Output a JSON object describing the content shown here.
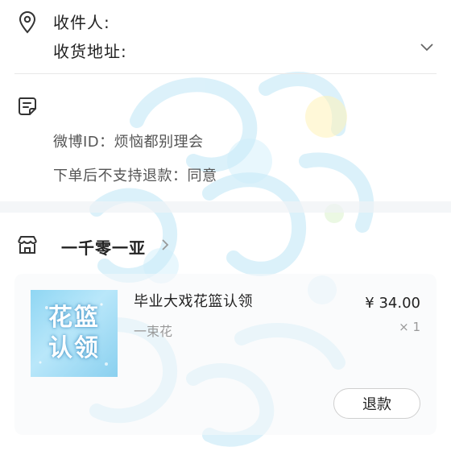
{
  "address": {
    "recipient_label": "收件人:",
    "address_label": "收货地址:"
  },
  "note": {
    "weibo_line": "微博ID：烦恼都别理会",
    "refund_policy_line": "下单后不支持退款：同意"
  },
  "shop": {
    "name": "一千零一亚"
  },
  "product": {
    "title": "毕业大戏花篮认领",
    "variant": "一束花",
    "price": "¥ 34.00",
    "quantity": "× 1",
    "thumbnail_text_line1": "花篮",
    "thumbnail_text_line2": "认领"
  },
  "actions": {
    "refund_label": "退款"
  },
  "icons": {
    "location": "location-pin-icon",
    "note": "note-icon",
    "shop": "shop-icon",
    "chevron_down": "chevron-down-icon",
    "chevron_right": "chevron-right-icon"
  },
  "colors": {
    "watermark": "#a9dcf0",
    "thumbnail_bg": "#8fd6f3",
    "text_primary": "#222222",
    "text_secondary": "#999999"
  }
}
